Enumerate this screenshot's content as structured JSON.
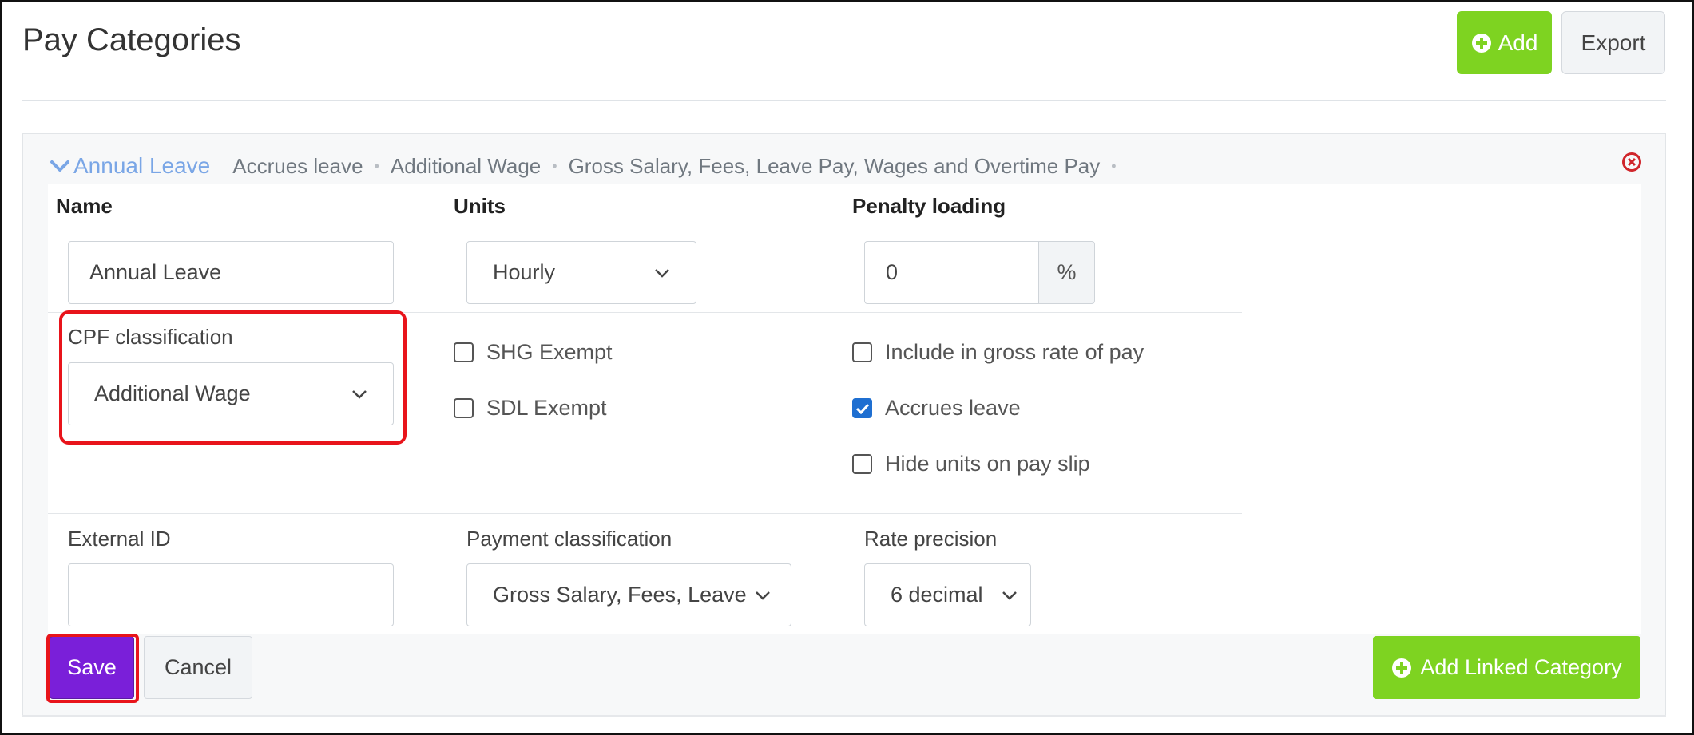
{
  "header": {
    "title": "Pay Categories",
    "add_label": "Add",
    "export_label": "Export"
  },
  "category": {
    "name": "Annual Leave",
    "tags": [
      "Accrues leave",
      "Additional Wage",
      "Gross Salary, Fees, Leave Pay, Wages and Overtime Pay"
    ]
  },
  "columns": {
    "name": "Name",
    "units": "Units",
    "penalty": "Penalty loading"
  },
  "form": {
    "name_value": "Annual Leave",
    "units_value": "Hourly",
    "penalty_value": "0",
    "penalty_suffix": "%",
    "cpf_label": "CPF classification",
    "cpf_value": "Additional Wage",
    "checks": {
      "shg": {
        "label": "SHG Exempt",
        "checked": false
      },
      "sdl": {
        "label": "SDL Exempt",
        "checked": false
      },
      "gross": {
        "label": "Include in gross rate of pay",
        "checked": false
      },
      "accrues": {
        "label": "Accrues leave",
        "checked": true
      },
      "hide_units": {
        "label": "Hide units on pay slip",
        "checked": false
      }
    },
    "external_id_label": "External ID",
    "external_id_value": "",
    "payment_label": "Payment classification",
    "payment_value": "Gross Salary, Fees, Leave",
    "rate_label": "Rate precision",
    "rate_value": "6 decimal"
  },
  "actions": {
    "save": "Save",
    "cancel": "Cancel",
    "add_linked": "Add Linked Category"
  },
  "colors": {
    "accent_green": "#7ed321",
    "save_purple": "#7a1fd9",
    "link_blue": "#7aa6e6",
    "highlight_red": "#e8141b"
  }
}
